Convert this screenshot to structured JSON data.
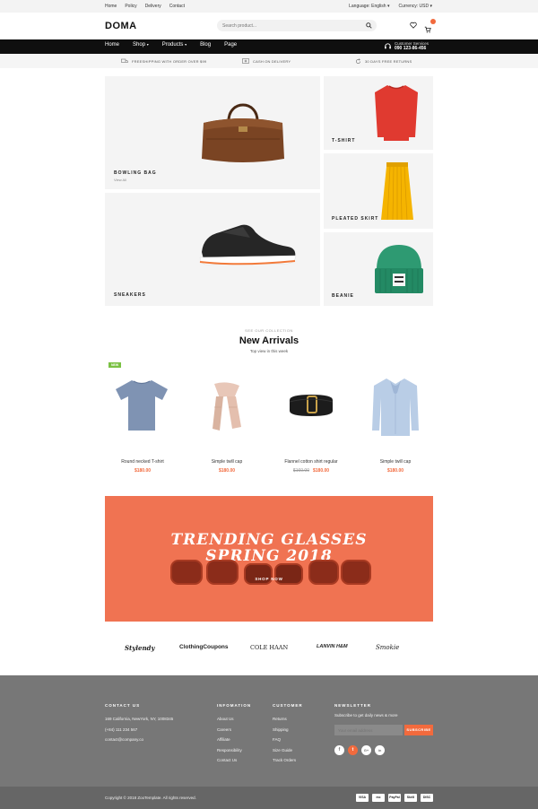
{
  "topbar": {
    "links": [
      "Home",
      "Policy",
      "Delivery",
      "Contact"
    ],
    "language": "Language: English",
    "currency": "Currency: USD"
  },
  "header": {
    "logo": "DOMA",
    "search_placeholder": "Search product...",
    "cart_count": ""
  },
  "nav": {
    "items": [
      "Home",
      "Shop",
      "Products",
      "Blog",
      "Page"
    ],
    "customer_service_label": "Customer Services",
    "customer_service_phone": "090 123-86-456"
  },
  "features": [
    "FREESHIPPING WITH ORDER OVER $99",
    "CASH ON DELIVERY",
    "30 DAYS FREE RETURNS"
  ],
  "tiles": {
    "bowling_bag": {
      "label": "BOWLING BAG",
      "link": "View All"
    },
    "tshirt": {
      "label": "T-SHIRT"
    },
    "sneakers": {
      "label": "SNEAKERS"
    },
    "pleated_skirt": {
      "label": "PLEATED SKIRT"
    },
    "beanie": {
      "label": "BEANIE"
    }
  },
  "arrivals": {
    "kicker": "SEE OUR COLLECTION",
    "title": "New Arrivals",
    "subtitle": "Top view in this week",
    "badge": "NEW",
    "products": [
      {
        "name": "Round necked T-shirt",
        "price": "$180.00",
        "old_price": ""
      },
      {
        "name": "Simple twill cap",
        "price": "$180.00",
        "old_price": ""
      },
      {
        "name": "Flannel cotton shirt regular",
        "price": "$180.00",
        "old_price": "$160.00"
      },
      {
        "name": "Simple twill cap",
        "price": "$180.00",
        "old_price": ""
      }
    ]
  },
  "banner": {
    "line1": "TRENDING GLASSES",
    "line2": "SPRING 2018",
    "cta": "SHOP NOW",
    "bg": "#f07352"
  },
  "brands": [
    "Stylendy",
    "ClothingCoupons",
    "COLE HAAN",
    "LANVIN H&M",
    "Smokie"
  ],
  "footer": {
    "contact": {
      "title": "CONTACT US",
      "address": "169 California, NewYork, NY, 1008345",
      "phone": "(+84) 111 234 567",
      "email": "contact@company.co"
    },
    "information": {
      "title": "INFOMATION",
      "links": [
        "About Us",
        "Careers",
        "Affiliate",
        "Responsibility",
        "Contact Us"
      ]
    },
    "customer": {
      "title": "CUSTOMER",
      "links": [
        "Returns",
        "Shipping",
        "FAQ",
        "Size Guide",
        "Track Orders"
      ]
    },
    "newsletter": {
      "title": "NEWSLETTER",
      "text": "Subscribe to get daily news & more",
      "placeholder": "Your email address",
      "button": "SUBSCRIBE",
      "social": [
        "f",
        "t",
        "G+",
        "in"
      ]
    }
  },
  "bottom": {
    "copyright": "Copyright © 2018  ZooTemplate. All rights reserved.",
    "payments": [
      "VISA",
      "mc",
      "PayPal",
      "Skrill",
      "DISC"
    ]
  },
  "colors": {
    "accent": "#f26a3d",
    "badge": "#7ac143",
    "footer": "#777777",
    "nav": "#0f0f0f"
  }
}
